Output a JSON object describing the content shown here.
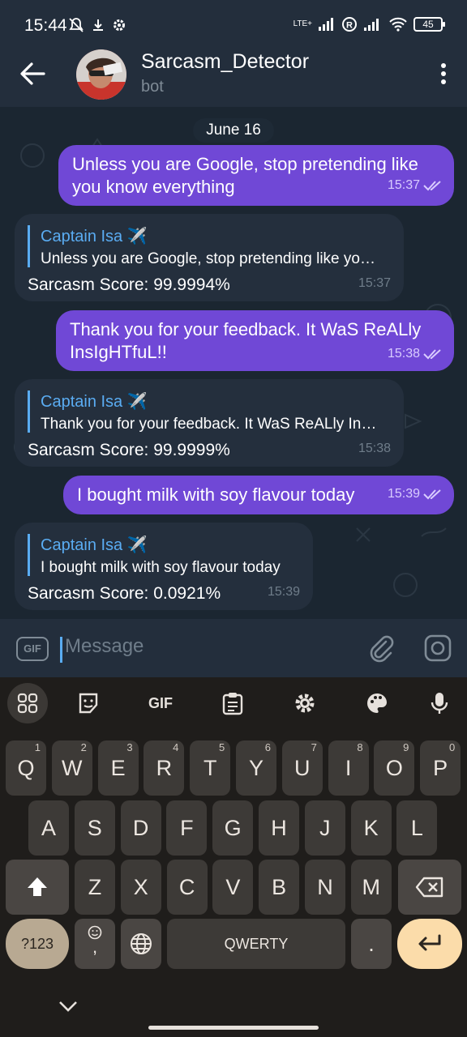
{
  "status_bar": {
    "time": "15:44",
    "network": "LTE+",
    "battery": "45"
  },
  "header": {
    "title": "Sarcasm_Detector",
    "subtitle": "bot"
  },
  "chat": {
    "date": "June 16",
    "messages": [
      {
        "type": "out",
        "text_line1": "Unless you are Google, stop pretending like",
        "text_line2": "you know everything",
        "time": "15:37"
      },
      {
        "type": "in",
        "reply_name": "Captain Isa ✈️",
        "reply_text": "Unless you are Google, stop pretending like yo…",
        "text": "Sarcasm Score: 99.9994%",
        "time": "15:37"
      },
      {
        "type": "out",
        "text_line1": "Thank you for your feedback. It WaS ReALly",
        "text_line2": "InsIgHTfuL!!",
        "time": "15:38"
      },
      {
        "type": "in",
        "reply_name": "Captain Isa ✈️",
        "reply_text": "Thank you for your feedback. It WaS ReALly In…",
        "text": "Sarcasm Score: 99.9999%",
        "time": "15:38"
      },
      {
        "type": "out",
        "text_line1": "I bought milk with soy flavour today",
        "time": "15:39"
      },
      {
        "type": "in",
        "reply_name": "Captain Isa ✈️",
        "reply_text": "I bought milk with soy flavour today",
        "text": "Sarcasm Score: 0.0921%",
        "time": "15:39"
      }
    ]
  },
  "input": {
    "gif_label": "GIF",
    "placeholder": "Message"
  },
  "keyboard": {
    "toolbar_gif": "GIF",
    "row1": [
      {
        "k": "Q",
        "n": "1"
      },
      {
        "k": "W",
        "n": "2"
      },
      {
        "k": "E",
        "n": "3"
      },
      {
        "k": "R",
        "n": "4"
      },
      {
        "k": "T",
        "n": "5"
      },
      {
        "k": "Y",
        "n": "6"
      },
      {
        "k": "U",
        "n": "7"
      },
      {
        "k": "I",
        "n": "8"
      },
      {
        "k": "O",
        "n": "9"
      },
      {
        "k": "P",
        "n": "0"
      }
    ],
    "row2": [
      "A",
      "S",
      "D",
      "F",
      "G",
      "H",
      "J",
      "K",
      "L"
    ],
    "row3": [
      "Z",
      "X",
      "C",
      "V",
      "B",
      "N",
      "M"
    ],
    "mode_key": "?123",
    "emoji_key_sub": ",",
    "space_label": "QWERTY",
    "period_key": "."
  }
}
